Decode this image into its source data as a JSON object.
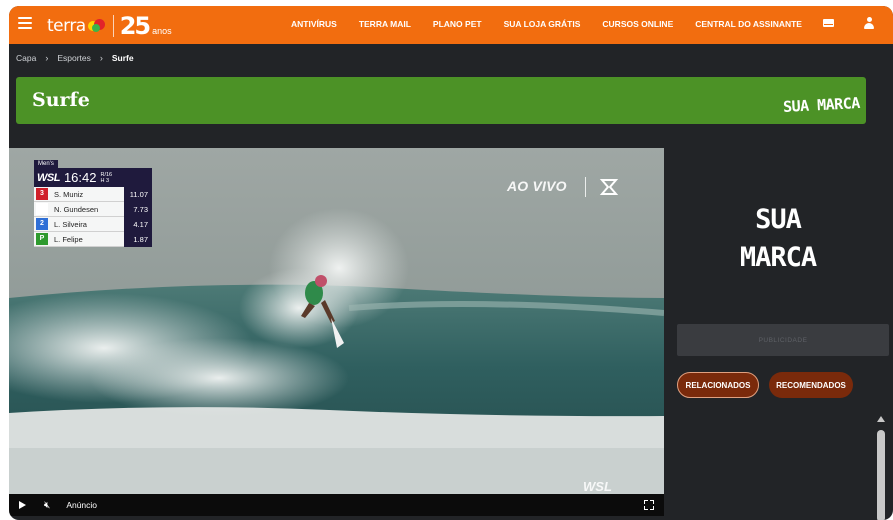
{
  "header": {
    "logo_text": "terra",
    "anniversary_number": "25",
    "anniversary_suffix": "anos",
    "nav": [
      "ANTIVÍRUS",
      "TERRA MAIL",
      "PLANO PET",
      "SUA LOJA GRÁTIS",
      "CURSOS ONLINE",
      "CENTRAL DO ASSINANTE"
    ],
    "accent_color": "#f26d0f"
  },
  "breadcrumb": {
    "items": [
      "Capa",
      "Esportes"
    ],
    "current": "Surfe"
  },
  "banner": {
    "title": "Surfe",
    "brand": "SUA MARCA",
    "color": "#4c9226"
  },
  "video": {
    "live_label": "AO VIVO",
    "watermark": "WSL",
    "controls": {
      "ad_label": "Anúncio"
    },
    "scoreboard": {
      "category": "Men's",
      "league": "WSL",
      "clock": "16:42",
      "round": "R/16",
      "heat": "H 3",
      "surfers": [
        {
          "chip": "3",
          "chip_color": "#d0202a",
          "name": "S. Muniz",
          "score": "11.07"
        },
        {
          "chip": "",
          "chip_color": "#ffffff",
          "name": "N. Gundesen",
          "score": "7.73"
        },
        {
          "chip": "2",
          "chip_color": "#2f6fd6",
          "name": "L. Silveira",
          "score": "4.17"
        },
        {
          "chip": "P",
          "chip_color": "#2e9a2e",
          "name": "L. Felipe",
          "score": "1.87"
        }
      ]
    }
  },
  "sidebar": {
    "brand_line1": "SUA",
    "brand_line2": "MARCA",
    "ad_label": "PUBLICIDADE",
    "tabs": [
      "RELACIONADOS",
      "RECOMENDADOS"
    ]
  }
}
